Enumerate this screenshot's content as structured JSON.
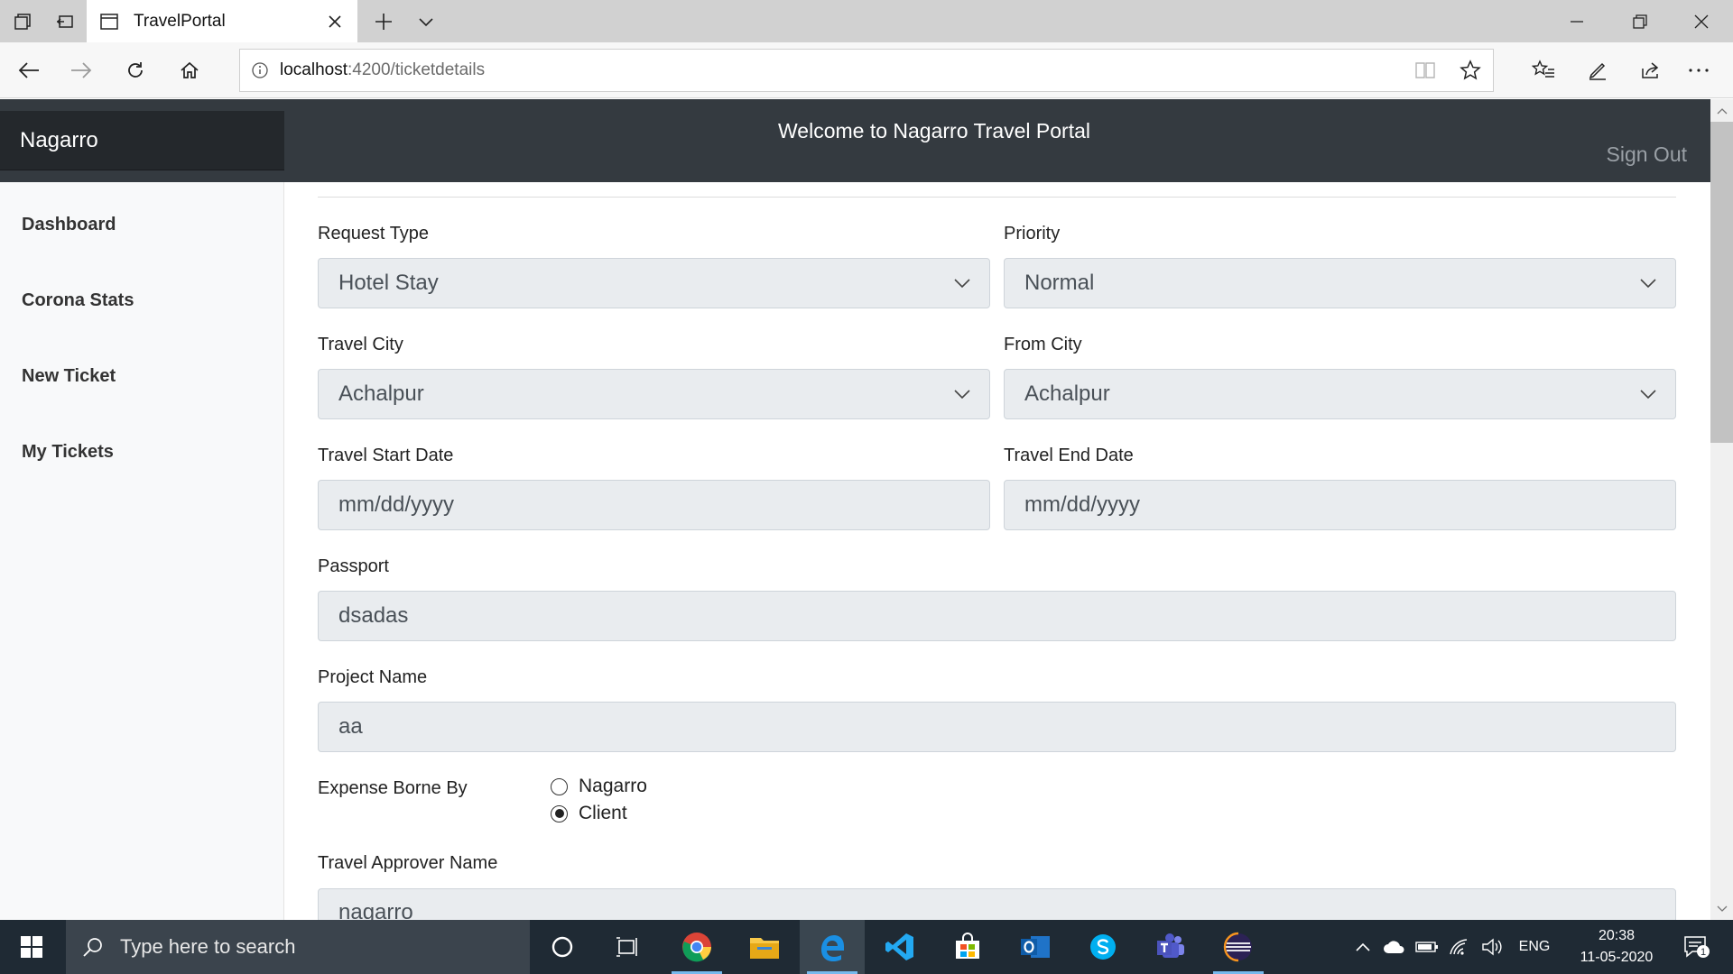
{
  "browser": {
    "tab_title": "TravelPortal",
    "url_host": "localhost",
    "url_path": ":4200/ticketdetails"
  },
  "header": {
    "brand": "Nagarro",
    "welcome": "Welcome to Nagarro Travel Portal",
    "signout": "Sign Out",
    "bg_color": "#343a40",
    "brand_bg_color": "#24282c"
  },
  "sidebar": {
    "items": [
      {
        "label": "Dashboard"
      },
      {
        "label": "Corona Stats"
      },
      {
        "label": "New Ticket"
      },
      {
        "label": "My Tickets"
      }
    ]
  },
  "form": {
    "request_type": {
      "label": "Request Type",
      "value": "Hotel Stay"
    },
    "priority": {
      "label": "Priority",
      "value": "Normal"
    },
    "travel_city": {
      "label": "Travel City",
      "value": "Achalpur"
    },
    "from_city": {
      "label": "From City",
      "value": "Achalpur"
    },
    "start_date": {
      "label": "Travel Start Date",
      "placeholder": "mm/dd/yyyy"
    },
    "end_date": {
      "label": "Travel End Date",
      "placeholder": "mm/dd/yyyy"
    },
    "passport": {
      "label": "Passport",
      "value": "dsadas"
    },
    "project_name": {
      "label": "Project Name",
      "value": "aa"
    },
    "expense": {
      "label": "Expense Borne By",
      "options": [
        {
          "label": "Nagarro",
          "selected": false
        },
        {
          "label": "Client",
          "selected": true
        }
      ]
    },
    "approver": {
      "label": "Travel Approver Name",
      "value": "nagarro"
    }
  },
  "taskbar": {
    "search_placeholder": "Type here to search",
    "language": "ENG",
    "time": "20:38",
    "date": "11-05-2020",
    "notification_count": "1"
  }
}
